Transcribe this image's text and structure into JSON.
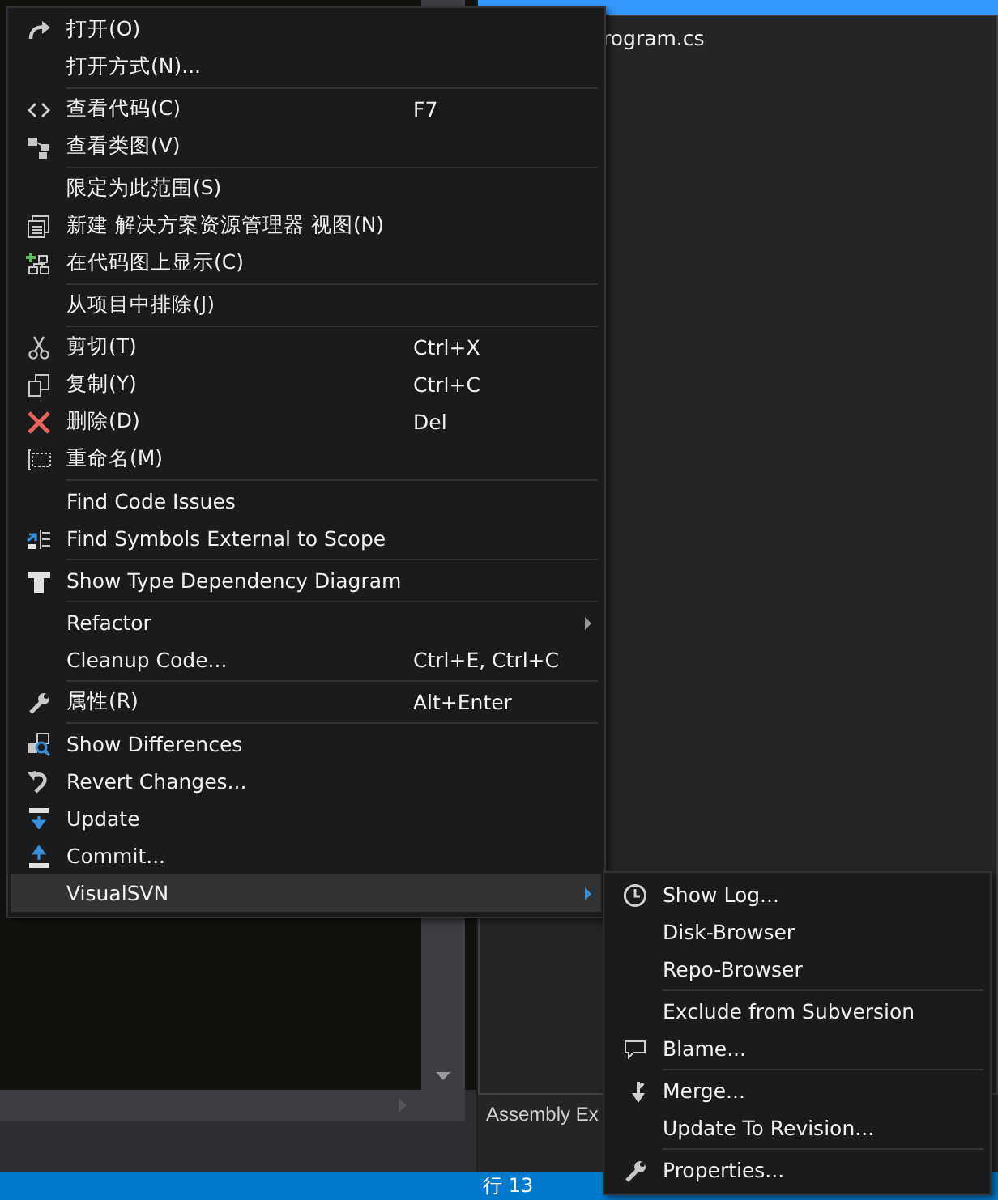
{
  "solution_explorer": {
    "file_item": "rogram.cs",
    "tab": "Assembly Ex"
  },
  "status_bar": {
    "line": "行 13"
  },
  "context_menu": {
    "items": [
      {
        "kind": "item",
        "label": "打开(O)",
        "selected": false
      },
      {
        "kind": "item",
        "label": "打开方式(N)...",
        "selected": false
      },
      {
        "kind": "separator"
      },
      {
        "kind": "item",
        "label": "查看代码(C)",
        "shortcut": "F7",
        "selected": false
      },
      {
        "kind": "item",
        "label": "查看类图(V)",
        "selected": false
      },
      {
        "kind": "separator"
      },
      {
        "kind": "item",
        "label": "限定为此范围(S)",
        "selected": false
      },
      {
        "kind": "item",
        "label": "新建 解决方案资源管理器 视图(N)",
        "selected": false
      },
      {
        "kind": "item",
        "label": "在代码图上显示(C)",
        "selected": false
      },
      {
        "kind": "separator"
      },
      {
        "kind": "item",
        "label": "从项目中排除(J)",
        "selected": false
      },
      {
        "kind": "separator"
      },
      {
        "kind": "item",
        "label": "剪切(T)",
        "shortcut": "Ctrl+X",
        "selected": false
      },
      {
        "kind": "item",
        "label": "复制(Y)",
        "shortcut": "Ctrl+C",
        "selected": false
      },
      {
        "kind": "item",
        "label": "删除(D)",
        "shortcut": "Del",
        "selected": false
      },
      {
        "kind": "item",
        "label": "重命名(M)",
        "selected": false
      },
      {
        "kind": "separator"
      },
      {
        "kind": "item",
        "label": "Find Code Issues",
        "selected": false
      },
      {
        "kind": "item",
        "label": "Find Symbols External to Scope",
        "selected": false
      },
      {
        "kind": "separator"
      },
      {
        "kind": "item",
        "label": "Show Type Dependency Diagram",
        "selected": false
      },
      {
        "kind": "separator"
      },
      {
        "kind": "submenu",
        "label": "Refactor",
        "selected": false
      },
      {
        "kind": "item",
        "label": "Cleanup Code...",
        "shortcut": "Ctrl+E, Ctrl+C",
        "selected": false
      },
      {
        "kind": "separator"
      },
      {
        "kind": "item",
        "label": "属性(R)",
        "shortcut": "Alt+Enter",
        "selected": false
      },
      {
        "kind": "separator"
      },
      {
        "kind": "item",
        "label": "Show Differences",
        "selected": false
      },
      {
        "kind": "item",
        "label": "Revert Changes...",
        "selected": false
      },
      {
        "kind": "item",
        "label": "Update",
        "selected": false
      },
      {
        "kind": "item",
        "label": "Commit...",
        "selected": false
      },
      {
        "kind": "submenu",
        "label": "VisualSVN",
        "selected": true
      }
    ]
  },
  "submenu": {
    "items": [
      {
        "kind": "item",
        "label": "Show Log...",
        "selected": false
      },
      {
        "kind": "item",
        "label": "Disk-Browser",
        "selected": false
      },
      {
        "kind": "item",
        "label": "Repo-Browser",
        "selected": false
      },
      {
        "kind": "separator"
      },
      {
        "kind": "item",
        "label": "Exclude from Subversion",
        "selected": false
      },
      {
        "kind": "item",
        "label": "Blame...",
        "selected": false
      },
      {
        "kind": "separator"
      },
      {
        "kind": "item",
        "label": "Merge...",
        "selected": false
      },
      {
        "kind": "item",
        "label": "Update To Revision...",
        "selected": false
      },
      {
        "kind": "separator"
      },
      {
        "kind": "item",
        "label": "Properties...",
        "selected": false
      }
    ]
  }
}
